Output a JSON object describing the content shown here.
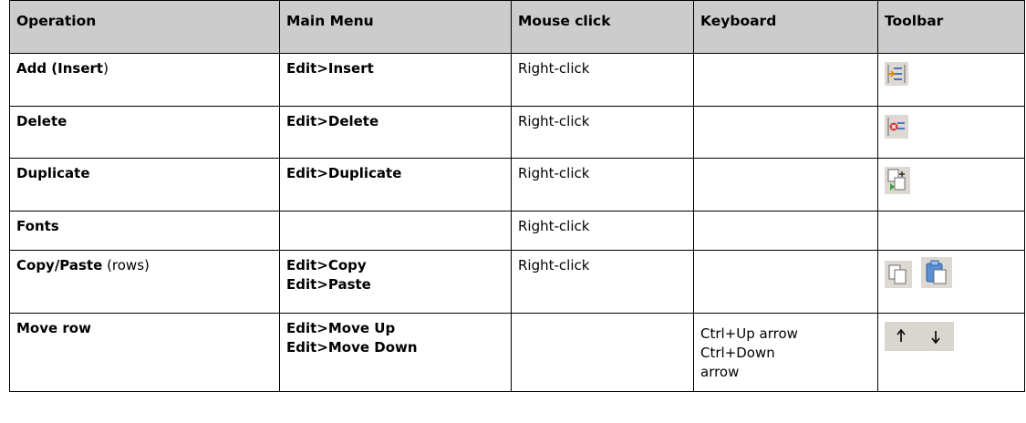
{
  "columns": [
    "Operation",
    "Main Menu",
    "Mouse click",
    "Keyboard",
    "Toolbar"
  ],
  "rows": [
    {
      "operation": "Add (Insert",
      "operation_suffix": ")",
      "menu": [
        "Edit>Insert"
      ],
      "mouse": "Right-click",
      "keyboard": [],
      "toolbar_icons": [
        "insert-row-icon"
      ]
    },
    {
      "operation": "Delete",
      "menu": [
        "Edit>Delete"
      ],
      "mouse": "Right-click",
      "keyboard": [],
      "toolbar_icons": [
        "delete-row-icon"
      ]
    },
    {
      "operation": "Duplicate",
      "menu": [
        "Edit>Duplicate"
      ],
      "mouse": "Right-click",
      "keyboard": [],
      "toolbar_icons": [
        "duplicate-row-icon"
      ]
    },
    {
      "operation": "Fonts",
      "menu": [],
      "mouse": "Right-click",
      "keyboard": [],
      "toolbar_icons": []
    },
    {
      "operation": "Copy/Paste",
      "operation_suffix": " (rows)",
      "menu": [
        "Edit>Copy",
        "Edit>Paste"
      ],
      "mouse": "Right-click",
      "keyboard": [],
      "toolbar_icons": [
        "copy-icon",
        "paste-icon"
      ]
    },
    {
      "operation": "Move row",
      "menu": [
        "Edit>Move Up",
        "Edit>Move Down"
      ],
      "mouse": "",
      "keyboard": [
        "Ctrl+Up arrow",
        "Ctrl+Down",
        "arrow"
      ],
      "toolbar_icons": [
        "move-up-icon",
        "move-down-icon"
      ]
    }
  ],
  "colors": {
    "header_bg": "#cccccc",
    "icon_bg": "#ddd9d2",
    "border": "#000000"
  }
}
